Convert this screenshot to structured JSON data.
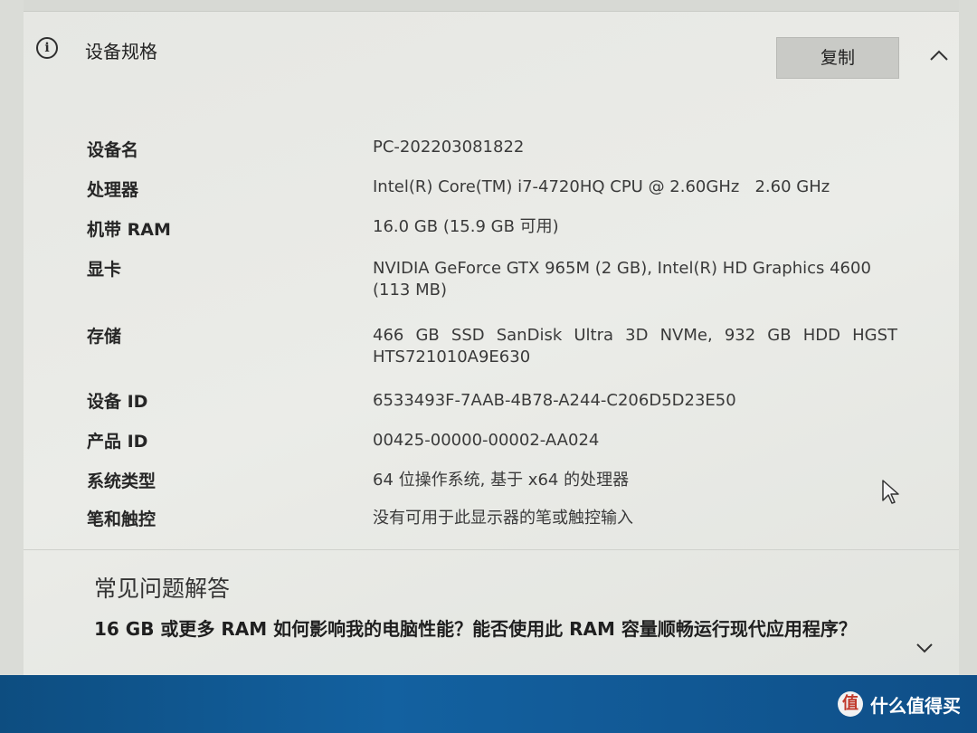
{
  "header": {
    "title": "设备规格",
    "copy_label": "复制"
  },
  "specs": [
    {
      "label": "设备名",
      "value": "PC-202203081822"
    },
    {
      "label": "处理器",
      "value": "Intel(R) Core(TM) i7-4720HQ CPU @ 2.60GHz   2.60 GHz"
    },
    {
      "label": "机带 RAM",
      "value": "16.0 GB (15.9 GB 可用)"
    },
    {
      "label": "显卡",
      "value": "NVIDIA GeForce GTX 965M (2 GB), Intel(R) HD Graphics 4600 (113 MB)"
    },
    {
      "label": "存储",
      "value": "466 GB SSD SanDisk Ultra 3D NVMe, 932 GB HDD HGST HTS721010A9E630"
    },
    {
      "label": "设备 ID",
      "value": "6533493F-7AAB-4B78-A244-C206D5D23E50"
    },
    {
      "label": "产品 ID",
      "value": "00425-00000-00002-AA024"
    },
    {
      "label": "系统类型",
      "value": "64 位操作系统, 基于 x64 的处理器"
    },
    {
      "label": "笔和触控",
      "value": "没有可用于此显示器的笔或触控输入"
    }
  ],
  "faq": {
    "title": "常见问题解答",
    "question": "16 GB 或更多 RAM 如何影响我的电脑性能？能否使用此 RAM 容量顺畅运行现代应用程序？"
  },
  "watermark": {
    "logo": "值",
    "text": "什么值得买"
  },
  "colors": {
    "panel": "#e8e9e5",
    "button": "#c9cac6",
    "taskbar": "#1361a0"
  }
}
